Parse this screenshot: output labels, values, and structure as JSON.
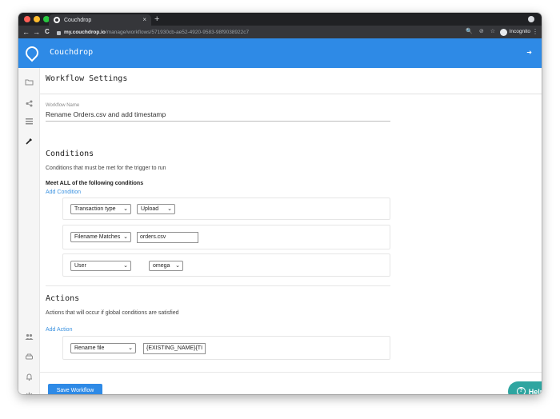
{
  "browser": {
    "tab_title": "Couchdrop",
    "tab_close": "×",
    "new_tab": "+",
    "back": "←",
    "forward": "→",
    "reload": "C",
    "url_host": "my.couchdrop.io",
    "url_path": "/manage/workflows/571930cb-ae52-4920-9583-98f9038922c7",
    "incognito_label": "Incognito",
    "menu": "⋮",
    "toolbar_icons": [
      "🔍",
      "⊘",
      "☆"
    ]
  },
  "app": {
    "brand": "Couchdrop",
    "logout_icon": "➜"
  },
  "page": {
    "title": "Workflow Settings",
    "workflow_name_label": "Workflow Name",
    "workflow_name_value": "Rename Orders.csv and add timestamp"
  },
  "conditions": {
    "heading": "Conditions",
    "description": "Conditions that must be met for the trigger to run",
    "meet_label": "Meet ALL of the following conditions",
    "add_label": "Add Condition",
    "items": [
      {
        "field": "Transaction type",
        "value": "Upload"
      },
      {
        "field": "Filename Matches",
        "value": "orders.csv"
      },
      {
        "field": "User",
        "value": "omega"
      }
    ]
  },
  "actions": {
    "heading": "Actions",
    "description": "Actions that will occur if global conditions are satisfied",
    "add_label": "Add Action",
    "items": [
      {
        "type": "Rename file",
        "value": "{EXISTING_NAME}{TI"
      }
    ]
  },
  "footer": {
    "save_label": "Save Workflow",
    "help_label": "Help",
    "help_icon": "?"
  },
  "colors": {
    "primary": "#2e8ae6",
    "help": "#2ea5a0",
    "link": "#3b92e0"
  }
}
